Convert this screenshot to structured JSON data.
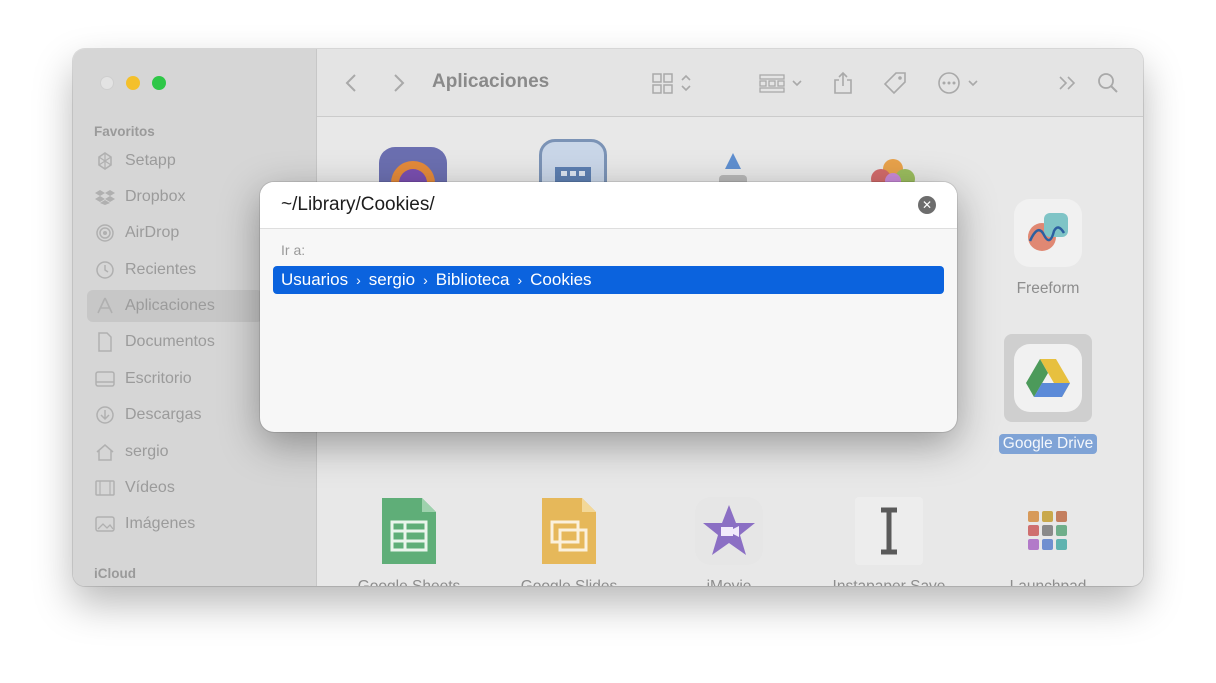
{
  "window": {
    "toolbar": {
      "title": "Aplicaciones"
    },
    "sidebar": {
      "sections": {
        "favorites": "Favoritos",
        "icloud": "iCloud"
      },
      "items": [
        {
          "label": "Setapp",
          "icon": "setapp-icon"
        },
        {
          "label": "Dropbox",
          "icon": "dropbox-icon"
        },
        {
          "label": "AirDrop",
          "icon": "airdrop-icon"
        },
        {
          "label": "Recientes",
          "icon": "clock-icon"
        },
        {
          "label": "Aplicaciones",
          "icon": "apps-icon",
          "active": true
        },
        {
          "label": "Documentos",
          "icon": "document-icon"
        },
        {
          "label": "Escritorio",
          "icon": "desktop-icon"
        },
        {
          "label": "Descargas",
          "icon": "download-icon"
        },
        {
          "label": "sergio",
          "icon": "home-icon"
        },
        {
          "label": "Vídeos",
          "icon": "film-icon"
        },
        {
          "label": "Imágenes",
          "icon": "image-icon"
        }
      ]
    },
    "apps": [
      {
        "label": "Freeform"
      },
      {
        "label": "Google Drive",
        "selected": true
      },
      {
        "label": "Google Sheets"
      },
      {
        "label": "Google Slides"
      },
      {
        "label": "iMovie"
      },
      {
        "label": "Instapaper Save"
      },
      {
        "label": "Launchpad"
      }
    ]
  },
  "dialog": {
    "path_value": "~/Library/Cookies/",
    "go_label": "Ir a:",
    "result_crumbs": [
      "Usuarios",
      "sergio",
      "Biblioteca",
      "Cookies"
    ],
    "crumb_separator": "›"
  },
  "colors": {
    "selection": "#0b63de",
    "accent_selected_label": "#7fa3d6"
  }
}
